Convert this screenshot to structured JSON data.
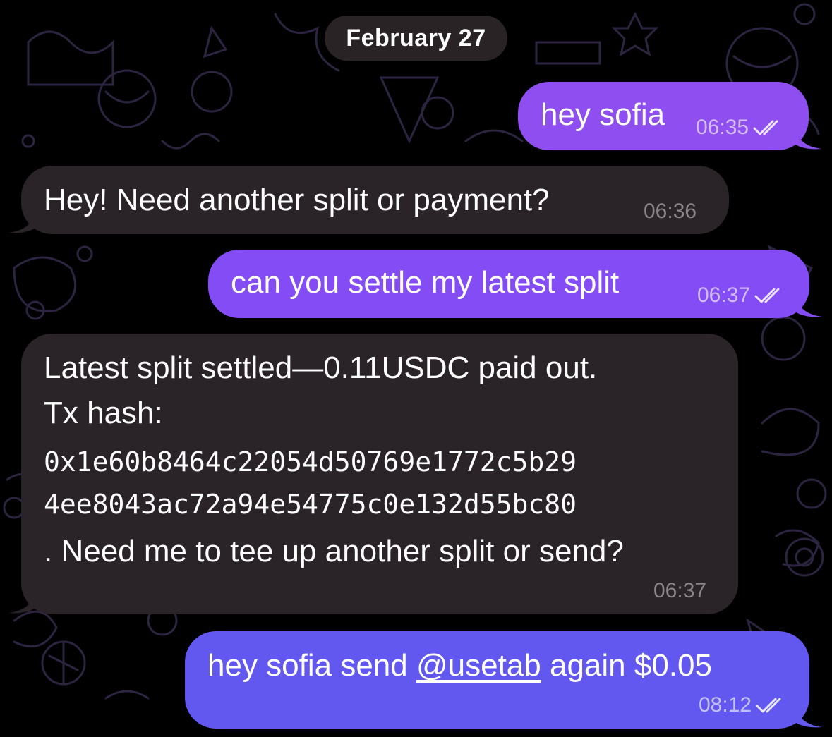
{
  "date_separator": "February 27",
  "messages": [
    {
      "id": 1,
      "direction": "outgoing",
      "text": "hey sofia",
      "time": "06:35",
      "status": "read"
    },
    {
      "id": 2,
      "direction": "incoming",
      "text": "Hey! Need another split or payment?",
      "time": "06:36"
    },
    {
      "id": 3,
      "direction": "outgoing",
      "text": "can you settle my latest split",
      "time": "06:37",
      "status": "read"
    },
    {
      "id": 4,
      "direction": "incoming",
      "lines": [
        "Latest split settled—0.11USDC paid out.",
        "Tx hash:",
        "0x1e60b8464c22054d50769e1772c5b29",
        "4ee8043ac72a94e54775c0e132d55bc80",
        ". Need me to tee up another split or send?"
      ],
      "time": "06:37"
    },
    {
      "id": 5,
      "direction": "outgoing",
      "text_before": "hey sofia send ",
      "mention": "@usetab",
      "text_after": " again $0.05",
      "time": "08:12",
      "status": "read"
    }
  ],
  "colors": {
    "background": "#000000",
    "outgoing_bubble": "#8f4ff0",
    "outgoing_bubble_latest": "#6258f0",
    "incoming_bubble": "#2a2428",
    "date_pill": "#2a2326",
    "doodle_stroke": "#2c2440"
  },
  "icons": {
    "read_receipt": "double-check-icon",
    "wallpaper": "doodle-pattern"
  }
}
